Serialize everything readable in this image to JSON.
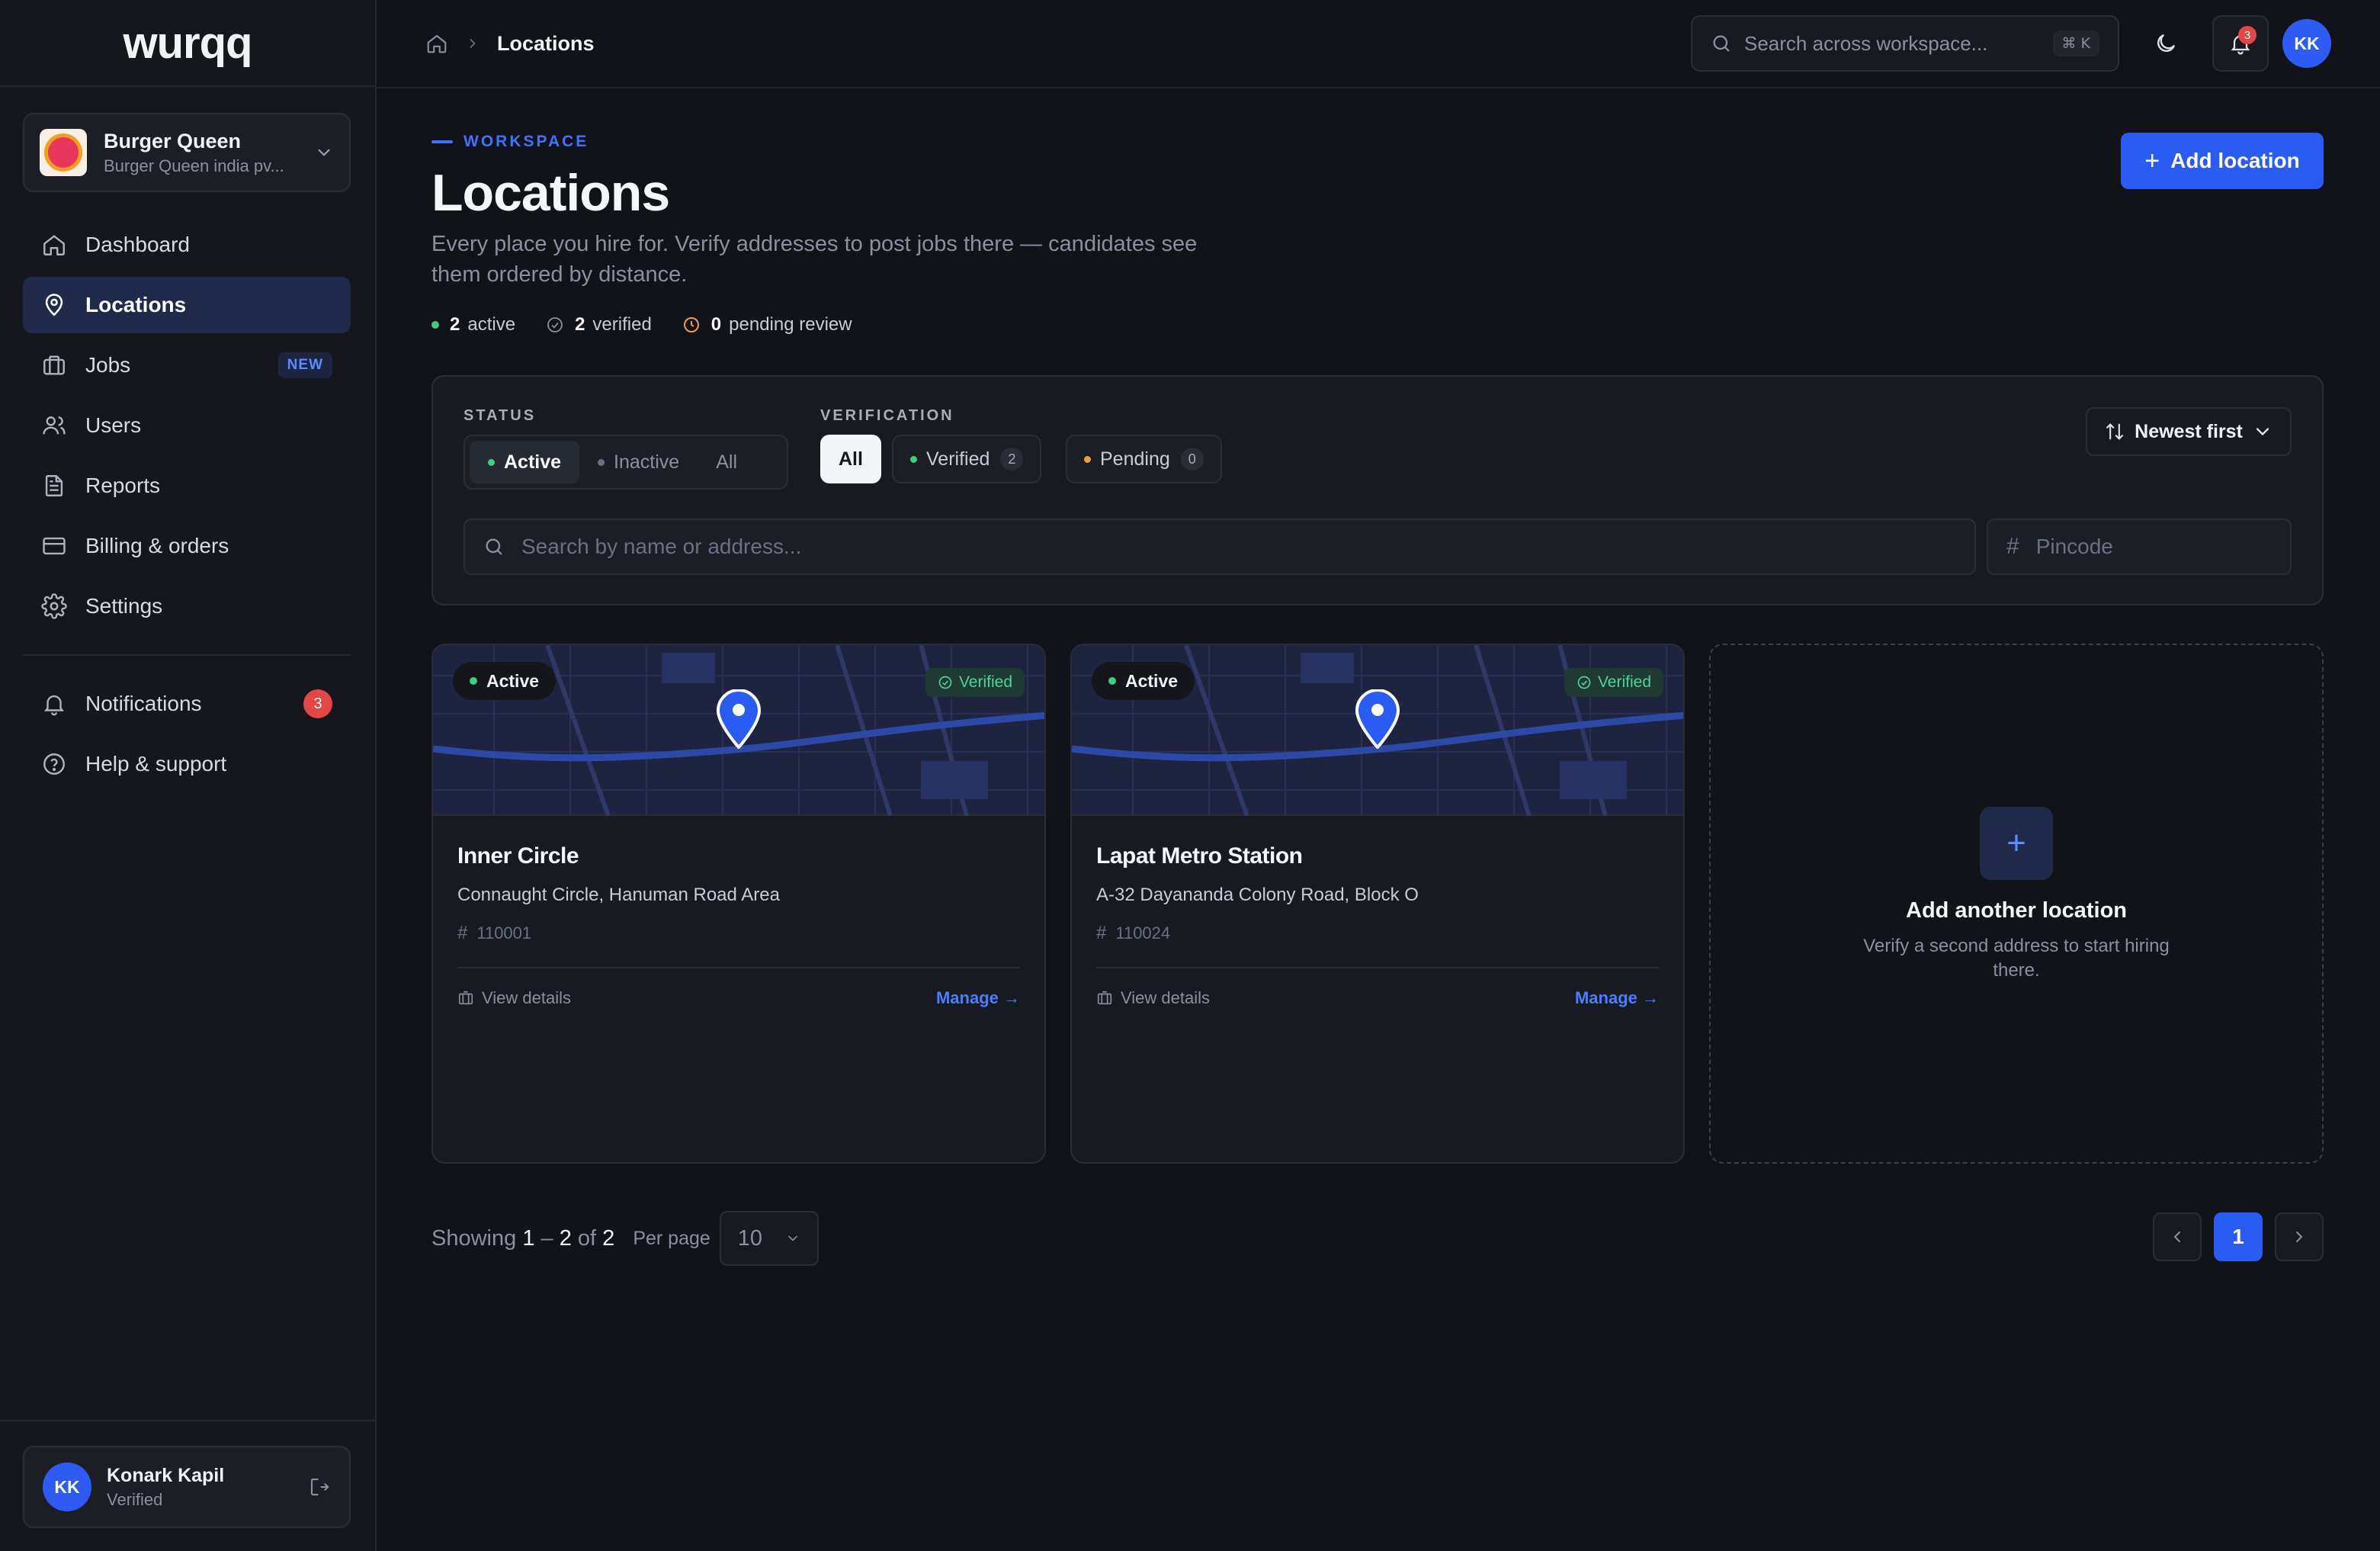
{
  "app": {
    "logo": "wurqq"
  },
  "org": {
    "name": "Burger Queen",
    "subtitle": "Burger Queen india pv..."
  },
  "sidebar": {
    "items": [
      {
        "label": "Dashboard",
        "icon": "home-icon"
      },
      {
        "label": "Locations",
        "icon": "map-pin-icon",
        "active": true
      },
      {
        "label": "Jobs",
        "icon": "briefcase-icon",
        "badge": "NEW"
      },
      {
        "label": "Users",
        "icon": "users-icon"
      },
      {
        "label": "Reports",
        "icon": "file-text-icon"
      },
      {
        "label": "Billing & orders",
        "icon": "credit-card-icon"
      },
      {
        "label": "Settings",
        "icon": "gear-icon"
      }
    ],
    "secondary": [
      {
        "label": "Notifications",
        "icon": "bell-icon",
        "count": "3"
      },
      {
        "label": "Help & support",
        "icon": "help-circle-icon"
      }
    ]
  },
  "user": {
    "initials": "KK",
    "name": "Konark Kapil",
    "status": "Verified"
  },
  "topbar": {
    "breadcrumb": "Locations",
    "search_placeholder": "Search across workspace...",
    "shortcut": "⌘ K",
    "notification_count": "3",
    "avatar_initials": "KK"
  },
  "header": {
    "eyebrow": "WORKSPACE",
    "title": "Locations",
    "description": "Every place you hire for. Verify addresses to post jobs there — candidates see them ordered by distance.",
    "add_button": "Add location"
  },
  "stats": [
    {
      "value": "2",
      "label": "active",
      "color": "#3ccf7f"
    },
    {
      "value": "2",
      "label": "verified",
      "color": "#8a90a0"
    },
    {
      "value": "0",
      "label": "pending review",
      "color": "#f0a03a"
    }
  ],
  "filters": {
    "status_label": "STATUS",
    "status_options": [
      "Active",
      "Inactive",
      "All"
    ],
    "status_selected": "Active",
    "verification_label": "VERIFICATION",
    "verification_options": [
      {
        "label": "All"
      },
      {
        "label": "Verified",
        "count": "2"
      },
      {
        "label": "Pending",
        "count": "0"
      }
    ],
    "verification_selected": "All",
    "sort_label": "Newest first",
    "search_placeholder": "Search by name or address...",
    "pincode_placeholder": "Pincode"
  },
  "locations": [
    {
      "status": "Active",
      "verification": "Verified",
      "name": "Inner Circle",
      "address": "Connaught Circle, Hanuman Road Area",
      "pincode": "110001",
      "view_label": "View details",
      "manage_label": "Manage →"
    },
    {
      "status": "Active",
      "verification": "Verified",
      "name": "Lapat Metro Station",
      "address": "A-32 Dayananda Colony Road, Block O",
      "pincode": "110024",
      "view_label": "View details",
      "manage_label": "Manage →"
    }
  ],
  "add_card": {
    "title": "Add another location",
    "subtitle": "Verify a second address to start hiring there."
  },
  "pagination": {
    "showing_prefix": "Showing",
    "range_start": "1",
    "range_dash": "–",
    "range_end": "2",
    "of": "of",
    "total": "2",
    "per_page_label": "Per page",
    "per_page_value": "10",
    "current_page": "1"
  },
  "colors": {
    "accent": "#2a5cf3",
    "background": "#111319",
    "active_green": "#3ccf7f",
    "pending_amber": "#f0a03a",
    "alert_red": "#e24646"
  }
}
